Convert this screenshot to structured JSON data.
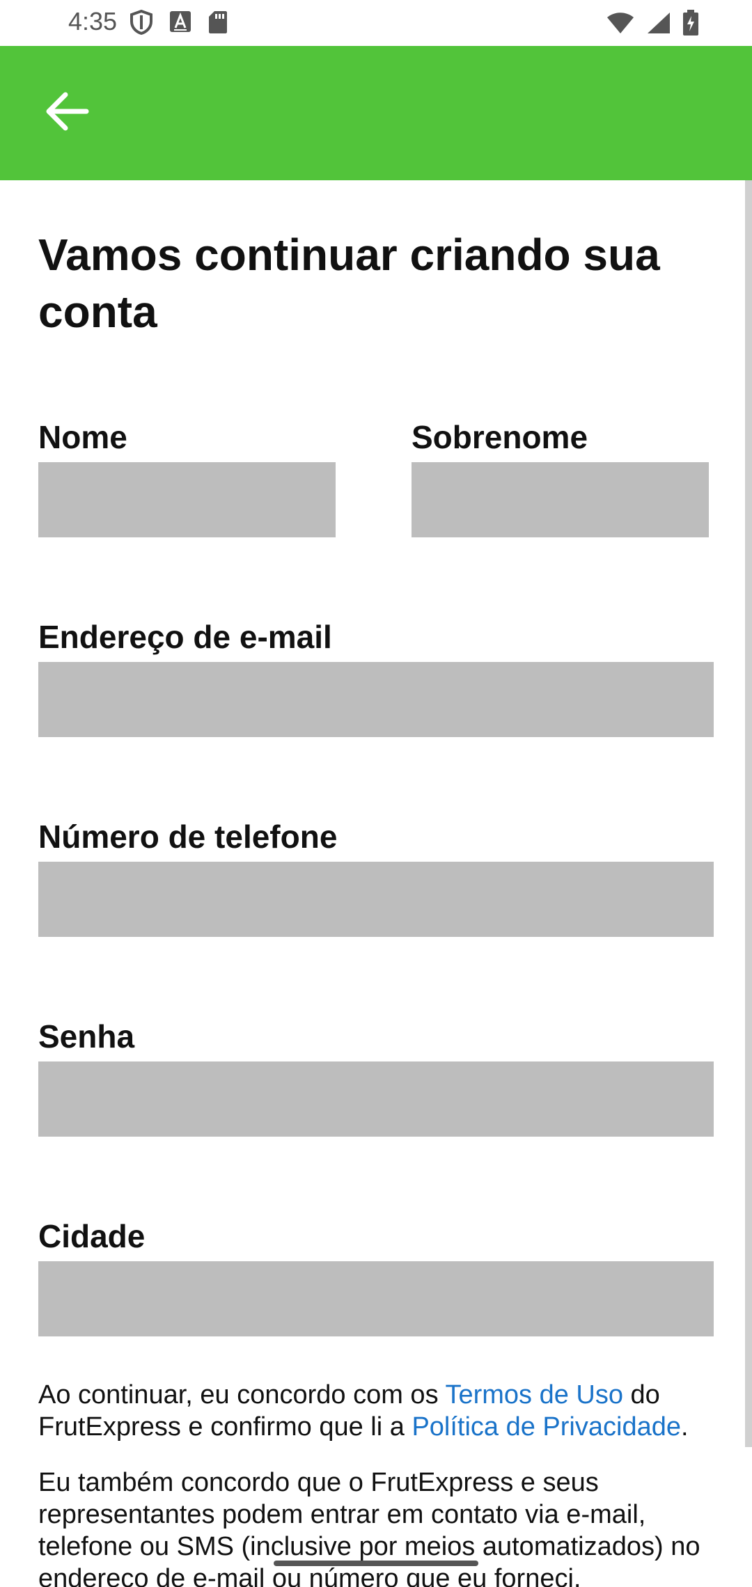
{
  "status_bar": {
    "time": "4:35",
    "left_icons": [
      "shield-icon",
      "keyboard-a-icon",
      "sd-card-icon"
    ],
    "right_icons": [
      "wifi-icon",
      "signal-icon",
      "battery-charging-icon"
    ]
  },
  "app_bar": {
    "color": "#52c43a",
    "back_icon": "arrow-left-icon"
  },
  "page": {
    "title": "Vamos continuar criando sua conta"
  },
  "form": {
    "first_name_label": "Nome",
    "first_name_value": "",
    "last_name_label": "Sobrenome",
    "last_name_value": "",
    "email_label": "Endereço de e-mail",
    "email_value": "",
    "phone_label": "Número de telefone",
    "phone_value": "",
    "password_label": "Senha",
    "password_value": "",
    "city_label": "Cidade",
    "city_value": ""
  },
  "legal": {
    "p1_part1": "Ao continuar, eu concordo com os ",
    "terms_link": "Termos de Uso",
    "p1_part2": " do FrutExpress e confirmo que li a ",
    "privacy_link": "Política de Privacidade",
    "p1_part3": ".",
    "p2": "Eu também concordo que o FrutExpress e seus representantes podem entrar em contato via e-mail, telefone ou SMS (inclusive por meios automatizados) no endereço de e-mail ou número que eu forneci,",
    "link_color": "#1a73c9"
  }
}
